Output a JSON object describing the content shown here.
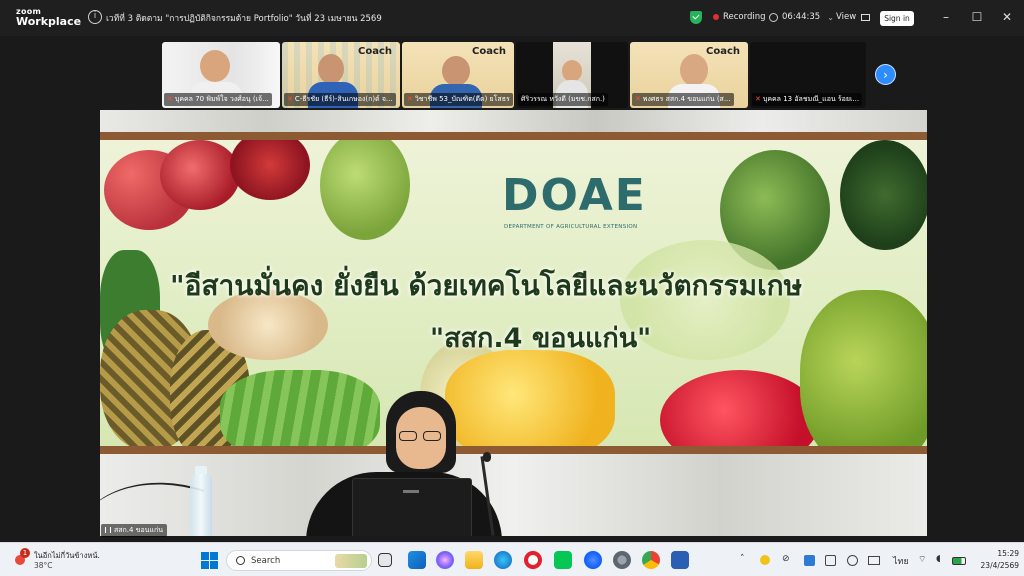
{
  "app": {
    "logo_top": "zoom",
    "logo_bottom": "Workplace",
    "meeting_title": "เวทีที่ 3 ติดตาม \"การปฏิบัติกิจกรรมด้าย Portfolio\" วันที่ 23 เมษายน 2569",
    "recording_label": "Recording",
    "timer": "06:44:35",
    "view_label": "View",
    "signin_label": "Sign in",
    "accent": "#2d8cff",
    "recording_color": "#e0302f"
  },
  "participants": [
    {
      "name": "บุคคล 70 พิมพ์ใจ  วงศ์อนุ (เจ้...",
      "coach": ""
    },
    {
      "name": "C-ธีรชัย (ธีร์)-สินเกษอง(ก)ต์ จ...",
      "coach": "Coach"
    },
    {
      "name": "วิชาชีพ 53_บัณฑิต(ดีต) ยโสธร",
      "coach": "Coach"
    },
    {
      "name": "ศิริวรรณ หวังดี (มขช.กสก.)",
      "coach": ""
    },
    {
      "name": "พงศธร สสก.4 ขอนแก่น (ส...",
      "coach": "Coach"
    },
    {
      "name": "บุคคล 13 อัลชมณี_แอน ร้อยเ...",
      "coach": ""
    }
  ],
  "stage": {
    "logo_text": "DOAE",
    "logo_sub": "DEPARTMENT OF AGRICULTURAL EXTENSION",
    "slogan_line1": "\"อีสานมั่นคง ยั่งยืน ด้วยเทคโนโลยีและนวัตกรรมเกษ",
    "slogan_line2": "\"สสก.4 ขอนแก่น\"",
    "speaker_name": "สสก.4 ขอนแก่น"
  },
  "taskbar": {
    "weather_text": "ในอีกไม่กี่วันข้างหน้...",
    "weather_temp": "38°C",
    "weather_badge": "1",
    "search_label": "Search",
    "language": "ไทย",
    "time": "15:29",
    "date": "23/4/2569"
  }
}
